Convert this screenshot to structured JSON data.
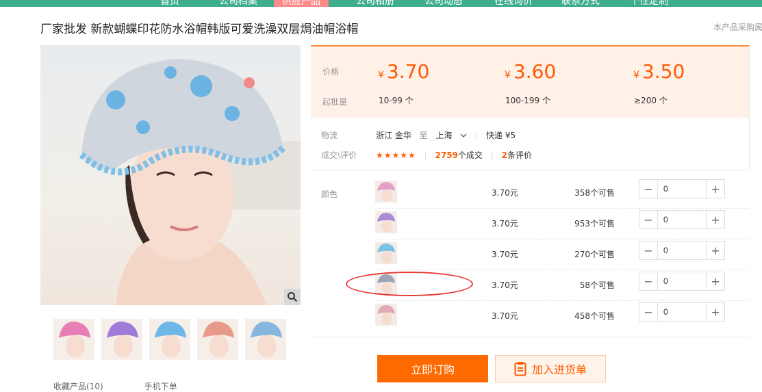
{
  "nav": {
    "items": [
      "首页",
      "公司档案",
      "供应产品",
      "公司相册",
      "公司动态",
      "在线询价",
      "联系方式",
      "个性定制"
    ],
    "active_index": 2
  },
  "product": {
    "title": "厂家批发 新款蝴蝶印花防水浴帽韩版可爱洗澡双层焗油帽浴帽",
    "note": "本产品采购属"
  },
  "price_box": {
    "price_label": "价格",
    "moq_label": "起批量",
    "currency": "¥",
    "tiers": [
      {
        "price": "3.70",
        "range": "10-99 个"
      },
      {
        "price": "3.60",
        "range": "100-199 个"
      },
      {
        "price": "3.50",
        "range": "≥200 个"
      }
    ]
  },
  "logistics": {
    "label": "物流",
    "from": "浙江 金华",
    "to_word": "至",
    "to": "上海",
    "method": "快递 ¥5"
  },
  "deals": {
    "label": "成交\\评价",
    "stars": "★★★★★",
    "rating": 5,
    "deal_count": "2759",
    "deal_suffix": "个成交",
    "review_count": "2",
    "review_suffix": "条评价"
  },
  "sku": {
    "label": "颜色",
    "rows": [
      {
        "price": "3.70元",
        "stock": "358个可售",
        "qty": "0",
        "color": "#e6a0c8"
      },
      {
        "price": "3.70元",
        "stock": "953个可售",
        "qty": "0",
        "color": "#a98ad6"
      },
      {
        "price": "3.70元",
        "stock": "270个可售",
        "qty": "0",
        "color": "#7cc3e6"
      },
      {
        "price": "3.70元",
        "stock": "58个可售",
        "qty": "0",
        "color": "#9aa6b8"
      },
      {
        "price": "3.70元",
        "stock": "458个可售",
        "qty": "0",
        "color": "#e3a8b8"
      }
    ]
  },
  "buttons": {
    "buy": "立即订购",
    "cart": "加入进货单"
  },
  "gallery": {
    "thumb_colors": [
      "#e67fb6",
      "#a07ad8",
      "#6fb7e6",
      "#e89a8a",
      "#86b6e0"
    ],
    "fav_text": "收藏产品(10)",
    "share_text": "手机下单"
  }
}
